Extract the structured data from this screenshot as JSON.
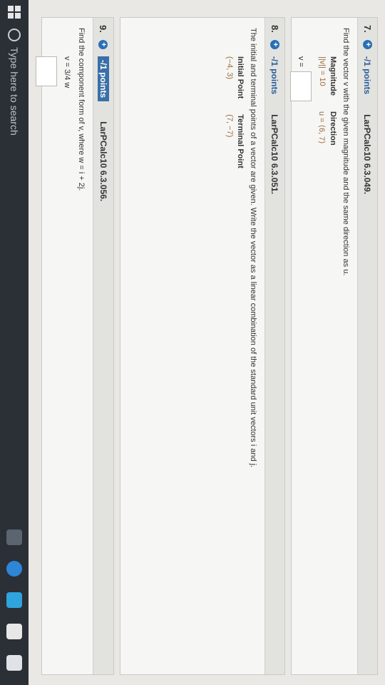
{
  "questions": [
    {
      "number": "7.",
      "points": "-/1 points",
      "source": "LarPCalc10 6.3.049.",
      "prompt": "Find the vector v with the given magnitude and the same direction as u.",
      "headers": [
        "Magnitude",
        "Direction"
      ],
      "values": [
        "||v|| = 10",
        "u = ⟨6, 7⟩"
      ],
      "answer_label": "v ="
    },
    {
      "number": "8.",
      "points": "-/1 points",
      "source": "LarPCalc10 6.3.051.",
      "prompt": "The initial and terminal points of a vector are given. Write the vector as a linear combination of the standard unit vectors i and j.",
      "headers": [
        "Initial Point",
        "Terminal Point"
      ],
      "values": [
        "(−4, 3)",
        "(7, −7)"
      ]
    },
    {
      "number": "9.",
      "points": "-/1 points",
      "source": "LarPCalc10 6.3.056.",
      "prompt": "Find the component form of v, where w = i + 2j.",
      "formula": "v = 3/4 w"
    }
  ],
  "taskbar": {
    "search_placeholder": "Type here to search"
  }
}
